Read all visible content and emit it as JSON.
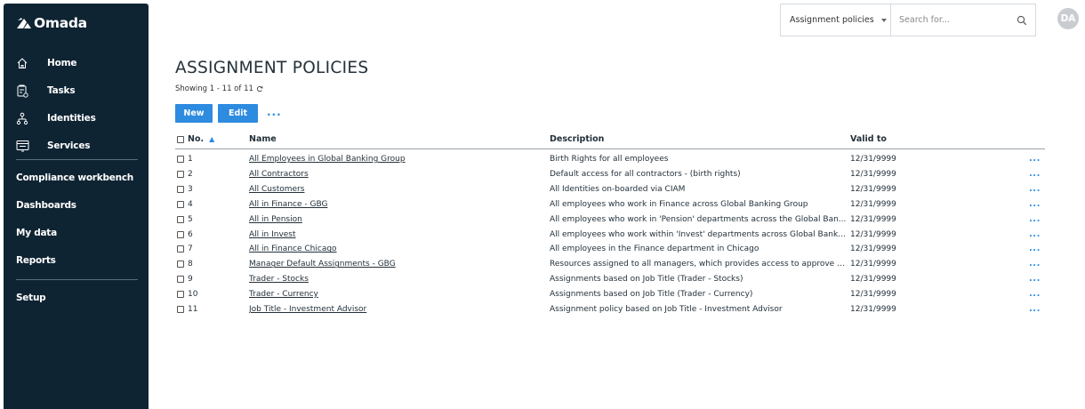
{
  "app": {
    "logo_text": "Omada",
    "avatar_initials": "DA"
  },
  "sidebar": {
    "primary": [
      {
        "label": "Home",
        "icon": "home-icon"
      },
      {
        "label": "Tasks",
        "icon": "tasks-icon"
      },
      {
        "label": "Identities",
        "icon": "identities-icon"
      },
      {
        "label": "Services",
        "icon": "services-icon"
      }
    ],
    "secondary": [
      "Compliance workbench",
      "Dashboards",
      "My data",
      "Reports"
    ],
    "setup": "Setup"
  },
  "search": {
    "scope": "Assignment policies",
    "placeholder": "Search for..."
  },
  "page": {
    "title": "ASSIGNMENT POLICIES",
    "showing": "Showing 1 - 11 of 11",
    "new_label": "New",
    "edit_label": "Edit",
    "more_label": "..."
  },
  "table": {
    "columns": {
      "no": "No.",
      "name": "Name",
      "description": "Description",
      "valid_to": "Valid to"
    },
    "rows": [
      {
        "no": "1",
        "name": "All Employees in Global Banking Group",
        "description": "Birth Rights for all employees",
        "valid_to": "12/31/9999"
      },
      {
        "no": "2",
        "name": "All Contractors",
        "description": "Default access for all contractors - (birth rights)",
        "valid_to": "12/31/9999"
      },
      {
        "no": "3",
        "name": "All Customers",
        "description": "All Identities on-boarded via CIAM",
        "valid_to": "12/31/9999"
      },
      {
        "no": "4",
        "name": "All in Finance - GBG",
        "description": "All employees who work in Finance across Global Banking Group",
        "valid_to": "12/31/9999"
      },
      {
        "no": "5",
        "name": "All in Pension",
        "description": "All employees who work in 'Pension' departments across the Global Ban...",
        "valid_to": "12/31/9999"
      },
      {
        "no": "6",
        "name": "All in Invest",
        "description": "All employees who work within 'Invest' departments across Global Banki...",
        "valid_to": "12/31/9999"
      },
      {
        "no": "7",
        "name": "All in Finance Chicago",
        "description": "All employees in the Finance department in Chicago",
        "valid_to": "12/31/9999"
      },
      {
        "no": "8",
        "name": "Manager Default Assignments - GBG",
        "description": "Resources assigned to all managers, which provides access to approve d...",
        "valid_to": "12/31/9999"
      },
      {
        "no": "9",
        "name": "Trader - Stocks",
        "description": "Assignments based on Job Title (Trader - Stocks)",
        "valid_to": "12/31/9999"
      },
      {
        "no": "10",
        "name": "Trader - Currency",
        "description": "Assignments based on Job Title (Trader - Currency)",
        "valid_to": "12/31/9999"
      },
      {
        "no": "11",
        "name": "Job Title - Investment Advisor",
        "description": "Assignment policy based on Job Title - Investment Advisor",
        "valid_to": "12/31/9999"
      }
    ],
    "row_more": "..."
  },
  "colors": {
    "sidebar_bg": "#0f2433",
    "accent": "#2d8be0"
  }
}
